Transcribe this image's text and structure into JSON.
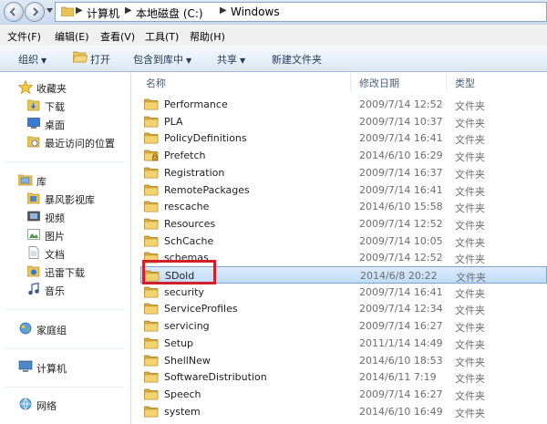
{
  "address": {
    "crumbs": [
      "计算机",
      "本地磁盘 (C:)",
      "Windows"
    ]
  },
  "menu": {
    "items": [
      "文件(F)",
      "编辑(E)",
      "查看(V)",
      "工具(T)",
      "帮助(H)"
    ]
  },
  "toolbar": {
    "organize": "组织",
    "open": "打开",
    "include_in_library": "包含到库中",
    "share": "共享",
    "new_folder": "新建文件夹"
  },
  "nav": {
    "favorites": "收藏夹",
    "downloads": "下载",
    "desktop": "桌面",
    "recent": "最近访问的位置",
    "libraries": "库",
    "video_lib_baofeng": "暴风影视库",
    "videos": "视频",
    "pictures": "图片",
    "documents": "文档",
    "xunlei": "迅雷下载",
    "music": "音乐",
    "homegroup": "家庭组",
    "computer": "计算机",
    "network": "网络"
  },
  "columns": {
    "name": "名称",
    "date": "修改日期",
    "type": "类型"
  },
  "files": [
    {
      "name": "Performance",
      "date": "2009/7/14 12:52",
      "type": "文件夹",
      "icon": "folder"
    },
    {
      "name": "PLA",
      "date": "2009/7/14 10:37",
      "type": "文件夹",
      "icon": "folder"
    },
    {
      "name": "PolicyDefinitions",
      "date": "2009/7/14 16:41",
      "type": "文件夹",
      "icon": "folder"
    },
    {
      "name": "Prefetch",
      "date": "2014/6/10 16:29",
      "type": "文件夹",
      "icon": "folder-locked"
    },
    {
      "name": "Registration",
      "date": "2009/7/14 16:37",
      "type": "文件夹",
      "icon": "folder"
    },
    {
      "name": "RemotePackages",
      "date": "2009/7/14 16:41",
      "type": "文件夹",
      "icon": "folder"
    },
    {
      "name": "rescache",
      "date": "2014/6/10 15:58",
      "type": "文件夹",
      "icon": "folder"
    },
    {
      "name": "Resources",
      "date": "2009/7/14 12:52",
      "type": "文件夹",
      "icon": "folder"
    },
    {
      "name": "SchCache",
      "date": "2009/7/14 10:05",
      "type": "文件夹",
      "icon": "folder"
    },
    {
      "name": "schemas",
      "date": "2009/7/14 12:52",
      "type": "文件夹",
      "icon": "folder"
    },
    {
      "name": "SDold",
      "date": "2014/6/8 20:22",
      "type": "文件夹",
      "icon": "folder",
      "selected": true
    },
    {
      "name": "security",
      "date": "2009/7/14 16:41",
      "type": "文件夹",
      "icon": "folder"
    },
    {
      "name": "ServiceProfiles",
      "date": "2009/7/14 12:34",
      "type": "文件夹",
      "icon": "folder"
    },
    {
      "name": "servicing",
      "date": "2009/7/14 16:27",
      "type": "文件夹",
      "icon": "folder"
    },
    {
      "name": "Setup",
      "date": "2011/1/14 14:49",
      "type": "文件夹",
      "icon": "folder"
    },
    {
      "name": "ShellNew",
      "date": "2014/6/10 18:53",
      "type": "文件夹",
      "icon": "folder"
    },
    {
      "name": "SoftwareDistribution",
      "date": "2014/6/11 7:19",
      "type": "文件夹",
      "icon": "folder"
    },
    {
      "name": "Speech",
      "date": "2009/7/14 16:27",
      "type": "文件夹",
      "icon": "folder"
    },
    {
      "name": "system",
      "date": "2014/6/10 16:49",
      "type": "文件夹",
      "icon": "folder"
    }
  ],
  "colors": {
    "selection_border": "#7da2ce",
    "highlight_annotation": "#d0202a",
    "folder_yellow": "#e8c35a"
  }
}
